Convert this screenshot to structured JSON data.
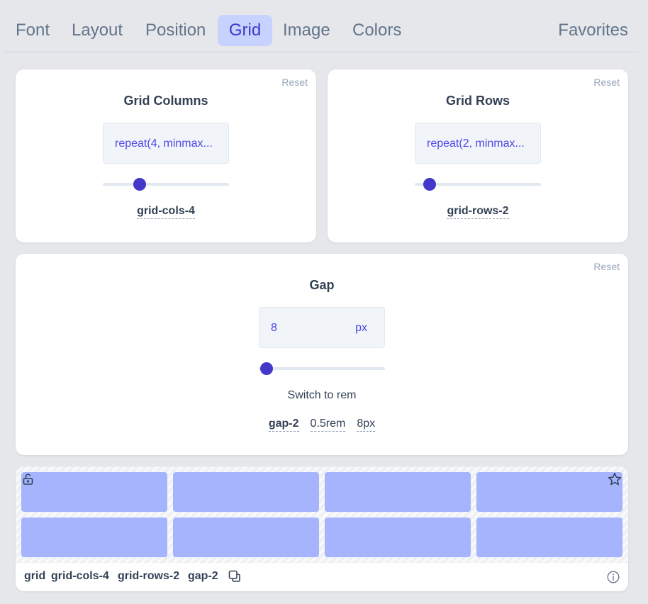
{
  "tabs": [
    {
      "label": "Font",
      "active": false
    },
    {
      "label": "Layout",
      "active": false
    },
    {
      "label": "Position",
      "active": false
    },
    {
      "label": "Grid",
      "active": true
    },
    {
      "label": "Image",
      "active": false
    },
    {
      "label": "Colors",
      "active": false
    }
  ],
  "favorites_label": "Favorites",
  "grid_columns": {
    "reset_label": "Reset",
    "title": "Grid Columns",
    "value": "repeat(4, minmax...",
    "slider_fraction": 0.29,
    "class_name": "grid-cols-4"
  },
  "grid_rows": {
    "reset_label": "Reset",
    "title": "Grid Rows",
    "value": "repeat(2, minmax...",
    "slider_fraction": 0.12,
    "class_name": "grid-rows-2"
  },
  "gap": {
    "reset_label": "Reset",
    "title": "Gap",
    "value": "8",
    "unit": "px",
    "slider_fraction": 0.06,
    "switch_label": "Switch to rem",
    "class_name": "gap-2",
    "rem_value": "0.5rem",
    "px_value": "8px"
  },
  "preview": {
    "grid_columns": 4,
    "grid_rows": 2,
    "classes": [
      "grid",
      "grid-cols-4",
      "grid-rows-2",
      "gap-2"
    ],
    "lock_icon": "unlock-icon",
    "favorite_icon": "star-icon",
    "copy_icon": "copy-icon",
    "info_icon": "info-icon"
  },
  "colors": {
    "accent": "#4338ca",
    "active_tab_bg": "#c7d2fe",
    "cell_fill": "#a5b4fc"
  }
}
